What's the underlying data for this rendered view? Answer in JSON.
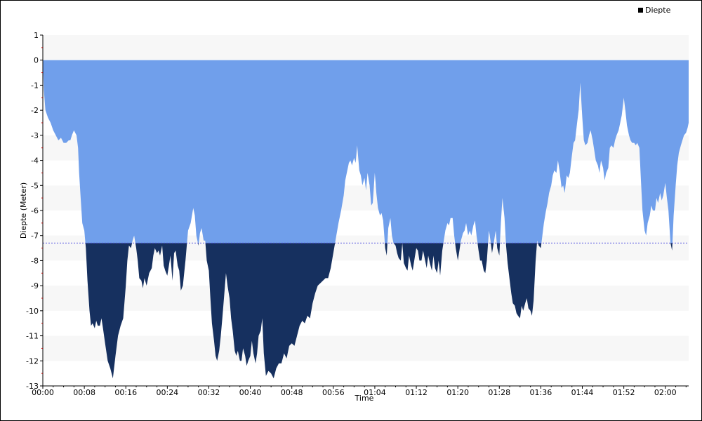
{
  "chart_data": {
    "type": "area",
    "xlabel": "Time",
    "ylabel": "Diepte (Meter)",
    "ylim": [
      -13,
      1
    ],
    "xlim_minutes": [
      0,
      124.5
    ],
    "yticks": [
      "1",
      "0",
      "-1",
      "-2",
      "-3",
      "-4",
      "-5",
      "-6",
      "-7",
      "-8",
      "-9",
      "-10",
      "-11",
      "-12",
      "-13"
    ],
    "xticks": [
      "00:00",
      "00:08",
      "00:16",
      "00:24",
      "00:32",
      "00:40",
      "00:48",
      "00:56",
      "01:04",
      "01:12",
      "01:20",
      "01:28",
      "01:36",
      "01:44",
      "01:52",
      "02:00"
    ],
    "threshold": -7.3,
    "grid": "alternating horizontal bands",
    "legend_position": "top-right",
    "colors": {
      "above": "#709FEB",
      "below": "#16305F",
      "threshold_line": "#5050E0",
      "band": "#F7F7F7"
    },
    "series": [
      {
        "name": "Diepte",
        "x_minutes": [
          0,
          0.2,
          0.5,
          1,
          1.5,
          2,
          2.5,
          3,
          3.5,
          4,
          4.5,
          5,
          5.3,
          5.6,
          6,
          6.5,
          6.8,
          7,
          7.3,
          7.6,
          8,
          8.3,
          8.6,
          9,
          9.3,
          9.6,
          10,
          10.3,
          10.6,
          11,
          11.3,
          11.6,
          12,
          12.5,
          13,
          13.5,
          14,
          14.5,
          15,
          15.5,
          16,
          16.3,
          16.6,
          17,
          17.3,
          17.6,
          18,
          18.3,
          18.6,
          19,
          19.3,
          19.6,
          20,
          20.5,
          21,
          21.3,
          21.6,
          22,
          22.3,
          22.6,
          23,
          23.3,
          23.6,
          24,
          24.3,
          24.6,
          25,
          25.3,
          25.6,
          26,
          26.3,
          26.6,
          27,
          27.5,
          28,
          28.5,
          29,
          29.3,
          29.6,
          30,
          30.3,
          30.6,
          31,
          31.3,
          31.6,
          32,
          32.3,
          32.6,
          33,
          33.3,
          33.6,
          34,
          34.3,
          34.6,
          35,
          35.3,
          35.6,
          36,
          36.3,
          36.6,
          37,
          37.3,
          37.6,
          38,
          38.3,
          38.6,
          39,
          39.3,
          39.6,
          40,
          40.3,
          40.6,
          41,
          41.3,
          41.6,
          42,
          42.3,
          42.6,
          43,
          43.5,
          44,
          44.5,
          45,
          45.5,
          46,
          46.5,
          47,
          47.5,
          48,
          48.5,
          49,
          49.5,
          50,
          50.5,
          51,
          51.5,
          52,
          52.5,
          53,
          53.5,
          54,
          54.5,
          55,
          55.5,
          56,
          56.5,
          57,
          57.5,
          58,
          58.3,
          58.6,
          59,
          59.3,
          59.6,
          60,
          60.3,
          60.6,
          61,
          61.3,
          61.6,
          62,
          62.3,
          62.6,
          63,
          63.3,
          63.6,
          64,
          64.3,
          64.6,
          65,
          65.3,
          65.6,
          66,
          66.3,
          66.6,
          67,
          67.3,
          67.6,
          68,
          68.3,
          68.6,
          69,
          69.3,
          69.6,
          70,
          70.3,
          70.6,
          71,
          71.3,
          71.6,
          72,
          72.3,
          72.6,
          73,
          73.3,
          73.6,
          74,
          74.3,
          74.6,
          75,
          75.3,
          75.6,
          76,
          76.3,
          76.6,
          77,
          77.3,
          77.6,
          78,
          78.3,
          78.6,
          79,
          79.3,
          79.6,
          80,
          80.3,
          80.6,
          81,
          81.3,
          81.6,
          82,
          82.3,
          82.6,
          83,
          83.3,
          83.6,
          84,
          84.3,
          84.6,
          85,
          85.3,
          85.6,
          86,
          86.3,
          86.6,
          87,
          87.3,
          87.6,
          88,
          88.3,
          88.6,
          89,
          89.3,
          89.6,
          90,
          90.3,
          90.6,
          91,
          91.3,
          91.6,
          92,
          92.3,
          92.6,
          93,
          93.3,
          93.6,
          94,
          94.3,
          94.6,
          95,
          95.3,
          95.6,
          96,
          96.3,
          96.6,
          97,
          97.3,
          97.6,
          98,
          98.3,
          98.6,
          99,
          99.3,
          99.6,
          100,
          100.3,
          100.6,
          101,
          101.3,
          101.6,
          102,
          102.3,
          102.6,
          103,
          103.3,
          103.6,
          104,
          104.3,
          104.6,
          105,
          105.3,
          105.6,
          106,
          106.3,
          106.6,
          107,
          107.3,
          107.6,
          108,
          108.3,
          108.6,
          109,
          109.3,
          109.6,
          110,
          110.3,
          110.6,
          111,
          111.3,
          111.6,
          112,
          112.3,
          112.6,
          113,
          113.3,
          113.6,
          114,
          114.3,
          114.6,
          115,
          115.3,
          115.6,
          116,
          116.3,
          116.6,
          117,
          117.3,
          117.6,
          118,
          118.3,
          118.6,
          119,
          119.3,
          119.6,
          120,
          120.3,
          120.6,
          121,
          121.3,
          121.6,
          122,
          122.3,
          122.6,
          123,
          123.3,
          123.6,
          124,
          124.3,
          124.5
        ],
        "y": [
          -0.1,
          -1.2,
          -2.0,
          -2.3,
          -2.5,
          -2.8,
          -3.0,
          -3.2,
          -3.1,
          -3.3,
          -3.3,
          -3.2,
          -3.2,
          -3.0,
          -2.8,
          -3.0,
          -3.5,
          -4.5,
          -5.5,
          -6.5,
          -6.8,
          -7.5,
          -8.8,
          -10.0,
          -10.6,
          -10.5,
          -10.7,
          -10.4,
          -10.6,
          -10.6,
          -10.3,
          -10.7,
          -11.3,
          -12.0,
          -12.3,
          -12.7,
          -11.8,
          -11.0,
          -10.6,
          -10.3,
          -9.0,
          -8.0,
          -7.4,
          -7.5,
          -7.2,
          -7.0,
          -7.5,
          -8.0,
          -8.7,
          -8.8,
          -9.1,
          -8.7,
          -9.0,
          -8.5,
          -8.3,
          -7.8,
          -7.5,
          -7.7,
          -7.6,
          -7.8,
          -7.4,
          -8.2,
          -8.4,
          -8.6,
          -8.2,
          -7.8,
          -8.8,
          -7.7,
          -7.6,
          -8.2,
          -8.4,
          -9.2,
          -9.0,
          -8.0,
          -6.8,
          -6.5,
          -5.9,
          -6.2,
          -7.0,
          -7.4,
          -6.9,
          -6.7,
          -7.2,
          -7.2,
          -8.0,
          -8.4,
          -9.5,
          -10.5,
          -11.2,
          -11.8,
          -12.0,
          -11.6,
          -11.0,
          -10.3,
          -9.3,
          -8.5,
          -9.0,
          -9.5,
          -10.3,
          -10.8,
          -11.6,
          -11.8,
          -11.6,
          -12.0,
          -12.0,
          -11.5,
          -11.8,
          -12.2,
          -12.0,
          -11.8,
          -11.2,
          -11.7,
          -12.1,
          -11.7,
          -11.0,
          -10.8,
          -10.3,
          -11.7,
          -12.6,
          -12.4,
          -12.5,
          -12.7,
          -12.3,
          -12.1,
          -12.1,
          -11.7,
          -11.9,
          -11.4,
          -11.3,
          -11.4,
          -11.0,
          -10.6,
          -10.4,
          -10.5,
          -10.2,
          -10.3,
          -9.7,
          -9.3,
          -9.0,
          -8.9,
          -8.8,
          -8.7,
          -8.7,
          -8.3,
          -7.7,
          -7.1,
          -6.5,
          -6.0,
          -5.4,
          -4.8,
          -4.5,
          -4.1,
          -4.0,
          -4.2,
          -3.9,
          -4.1,
          -3.4,
          -4.4,
          -4.6,
          -5.0,
          -4.7,
          -5.2,
          -4.5,
          -5.0,
          -5.8,
          -5.7,
          -4.5,
          -5.3,
          -5.9,
          -6.2,
          -6.1,
          -6.4,
          -7.5,
          -7.8,
          -6.7,
          -6.3,
          -7.0,
          -7.3,
          -7.4,
          -7.7,
          -7.9,
          -8.0,
          -7.3,
          -8.1,
          -8.3,
          -8.4,
          -7.8,
          -8.2,
          -8.4,
          -8.0,
          -7.5,
          -7.6,
          -8.0,
          -8.0,
          -7.6,
          -7.9,
          -8.3,
          -7.8,
          -8.1,
          -8.4,
          -7.8,
          -8.3,
          -8.5,
          -8.0,
          -8.6,
          -7.6,
          -7.2,
          -6.8,
          -6.5,
          -6.6,
          -6.3,
          -6.3,
          -7.0,
          -7.5,
          -8.0,
          -7.6,
          -7.2,
          -6.9,
          -6.8,
          -6.5,
          -7.0,
          -6.8,
          -7.0,
          -6.6,
          -6.4,
          -7.0,
          -7.6,
          -8.0,
          -8.0,
          -8.4,
          -8.5,
          -8.0,
          -6.8,
          -7.2,
          -7.7,
          -7.2,
          -6.8,
          -7.5,
          -7.8,
          -6.5,
          -5.5,
          -6.3,
          -7.4,
          -8.1,
          -8.8,
          -9.3,
          -9.7,
          -9.8,
          -10.1,
          -10.2,
          -10.3,
          -9.8,
          -10.0,
          -9.7,
          -9.5,
          -9.9,
          -10.0,
          -10.2,
          -9.6,
          -8.0,
          -7.2,
          -7.4,
          -7.5,
          -7.0,
          -6.5,
          -6.0,
          -5.7,
          -5.3,
          -5.0,
          -4.6,
          -4.4,
          -4.5,
          -4.0,
          -4.4,
          -5.1,
          -5.0,
          -5.3,
          -4.6,
          -4.7,
          -4.5,
          -3.8,
          -3.3,
          -3.2,
          -2.5,
          -2.0,
          -0.9,
          -2.3,
          -3.2,
          -3.4,
          -3.3,
          -3.0,
          -2.8,
          -3.2,
          -3.6,
          -4.0,
          -4.2,
          -4.5,
          -4.0,
          -4.3,
          -4.8,
          -4.5,
          -4.3,
          -3.5,
          -3.4,
          -3.5,
          -3.2,
          -3.0,
          -2.8,
          -2.5,
          -2.2,
          -1.5,
          -2.0,
          -2.6,
          -3.0,
          -3.2,
          -3.3,
          -3.3,
          -3.4,
          -3.3,
          -3.5,
          -4.8,
          -6.0,
          -6.8,
          -7.0,
          -6.5,
          -6.2,
          -5.8,
          -6.0,
          -6.0,
          -5.5,
          -5.7,
          -5.3,
          -5.6,
          -5.4,
          -4.9,
          -5.5,
          -6.0,
          -7.3,
          -7.6,
          -6.2,
          -5.0,
          -4.2,
          -3.7,
          -3.4,
          -3.2,
          -3.0,
          -2.9,
          -2.7,
          -2.5,
          -2.0,
          -1.8
        ]
      }
    ]
  }
}
